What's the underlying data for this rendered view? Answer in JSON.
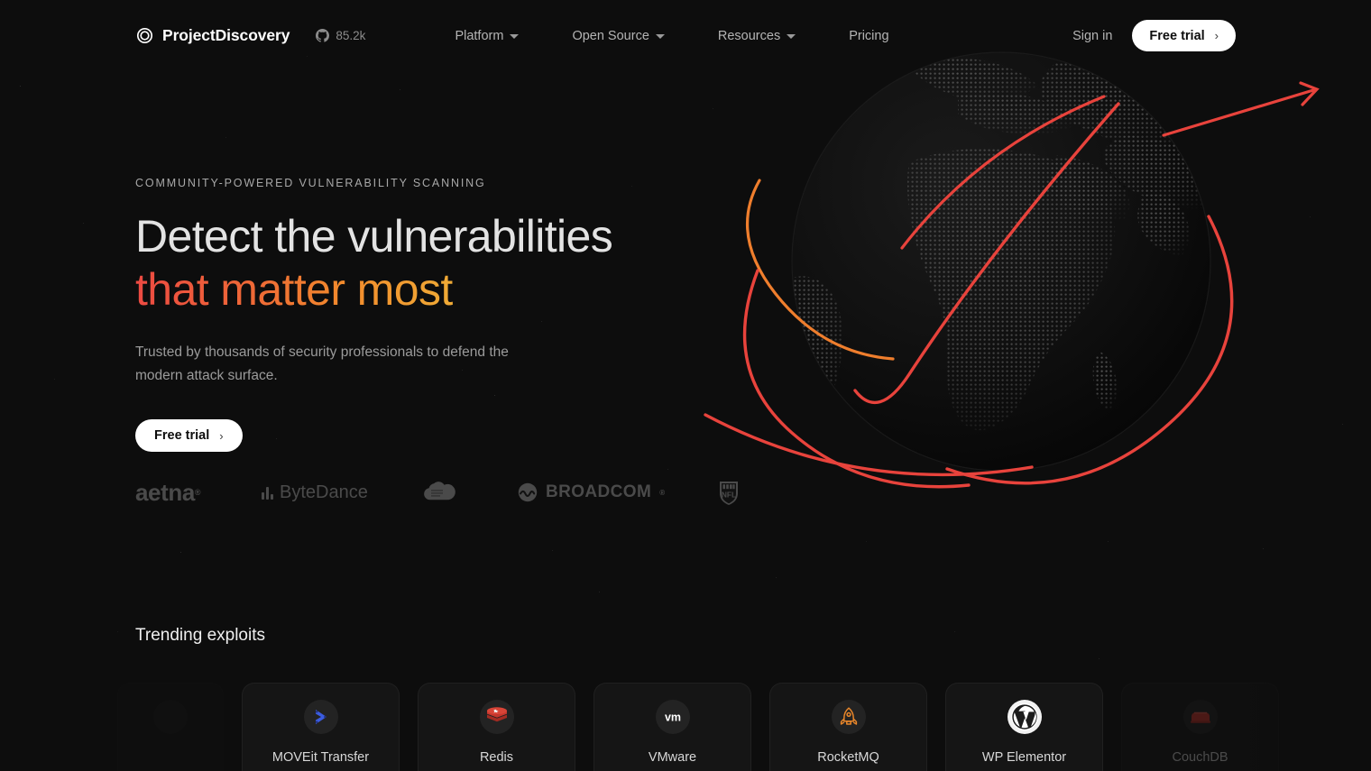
{
  "brand": {
    "name": "ProjectDiscovery",
    "logo_icon": "spiral-logo-icon"
  },
  "github": {
    "icon": "github-icon",
    "stars": "85.2k"
  },
  "nav": {
    "items": [
      {
        "label": "Platform",
        "has_dropdown": true
      },
      {
        "label": "Open Source",
        "has_dropdown": true
      },
      {
        "label": "Resources",
        "has_dropdown": true
      },
      {
        "label": "Pricing",
        "has_dropdown": false
      }
    ],
    "sign_in": "Sign in",
    "cta": "Free trial",
    "cta_chevron": "›"
  },
  "hero": {
    "eyebrow": "COMMUNITY-POWERED VULNERABILITY SCANNING",
    "headline_line1": "Detect the vulnerabilities",
    "headline_line2": "that matter most",
    "subtitle": "Trusted by thousands of security professionals to defend the modern attack surface.",
    "cta": "Free trial",
    "cta_chevron": "›",
    "gradient_start": "#ec4a42",
    "gradient_end": "#f0ab36"
  },
  "logos": [
    {
      "name": "aetna",
      "label": "aetna"
    },
    {
      "name": "bytedance",
      "label": "ByteDance"
    },
    {
      "name": "salesforce",
      "label": "Salesforce"
    },
    {
      "name": "broadcom",
      "label": "BROADCOM"
    },
    {
      "name": "nfl",
      "label": "NFL"
    }
  ],
  "trending": {
    "title": "Trending exploits",
    "cards": [
      {
        "label": "",
        "icon": "partial-card-icon",
        "state": "faded2"
      },
      {
        "label": "MOVEit Transfer",
        "icon": "moveit-icon",
        "state": "normal"
      },
      {
        "label": "Redis",
        "icon": "redis-icon",
        "state": "normal"
      },
      {
        "label": "VMware",
        "icon": "vmware-icon",
        "state": "normal"
      },
      {
        "label": "RocketMQ",
        "icon": "rocketmq-icon",
        "state": "normal"
      },
      {
        "label": "WP Elementor",
        "icon": "wordpress-icon",
        "state": "normal"
      },
      {
        "label": "CouchDB",
        "icon": "couchdb-icon",
        "state": "faded"
      }
    ]
  },
  "theme": {
    "background": "#0d0d0d",
    "card_background": "#151515",
    "accent_red": "#e8433c",
    "accent_orange": "#ef7e2d",
    "text_primary": "#e9e9e9",
    "text_muted": "#9b9b9b"
  },
  "graphic": {
    "name": "dotted-globe-with-trajectory-arcs",
    "dot_color": "#555555",
    "arc_red": "#e8433c",
    "arc_orange": "#ef7e2d"
  }
}
